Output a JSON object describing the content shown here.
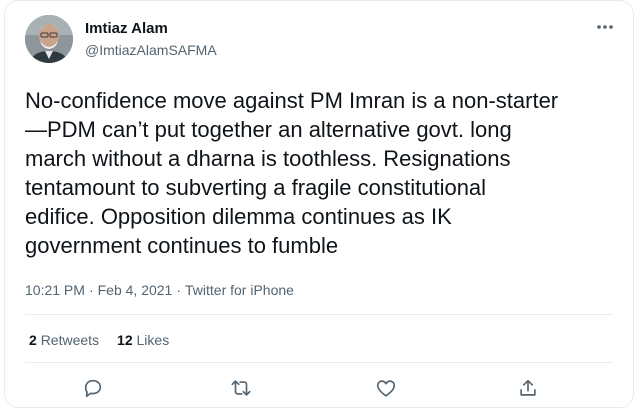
{
  "tweet": {
    "author": {
      "name": "Imtiaz Alam",
      "handle": "@ImtiazAlamSAFMA"
    },
    "text": "No-confidence move against PM Imran is a non-starter\n—PDM can’t put together an alternative govt. long\nmarch without a dharna is toothless. Resignations\ntentamount to subverting a fragile constitutional\nedifice. Opposition dilemma continues as IK\ngovernment continues to fumble",
    "time": "10:21 PM",
    "date": "Feb 4, 2021",
    "separator": "·",
    "source": "Twitter for iPhone",
    "stats": {
      "retweets_count": "2",
      "retweets_label": "Retweets",
      "likes_count": "12",
      "likes_label": "Likes"
    }
  },
  "icons": {
    "more": "more-horizontal-icon",
    "reply": "reply-icon",
    "retweet": "retweet-icon",
    "like": "heart-icon",
    "share": "share-icon"
  },
  "colors": {
    "text": "#0f1419",
    "secondary": "#536471",
    "border": "#e6ecf0"
  }
}
